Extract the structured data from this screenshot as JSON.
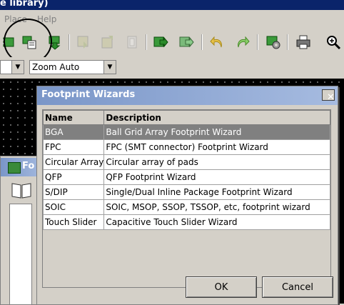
{
  "window": {
    "title": "e library)"
  },
  "menubar": {
    "items": [
      "Place",
      "Help"
    ]
  },
  "toolbar": {
    "buttons": [
      "new-footprint-icon",
      "footprint-wizard-icon",
      "load-footprint-icon",
      "save-library-icon",
      "export-icon",
      "delete-icon",
      "insert-board-icon",
      "update-board-icon",
      "undo-icon",
      "redo-icon",
      "settings-icon",
      "print-icon",
      "zoom-icon"
    ]
  },
  "toolbar2": {
    "zoom_value": "Zoom Auto"
  },
  "back_window": {
    "title": "Fo"
  },
  "dialog": {
    "title": "Footprint Wizards",
    "close_label": "✕",
    "columns": {
      "name": "Name",
      "description": "Description"
    },
    "rows": [
      {
        "name": "BGA",
        "description": "Ball Grid Array Footprint Wizard",
        "selected": true
      },
      {
        "name": "FPC",
        "description": "FPC (SMT connector) Footprint Wizard"
      },
      {
        "name": "Circular Array",
        "description": "Circular array of pads"
      },
      {
        "name": "QFP",
        "description": "QFP Footprint Wizard"
      },
      {
        "name": "S/DIP",
        "description": "Single/Dual Inline Package Footprint Wizard"
      },
      {
        "name": "SOIC",
        "description": "SOIC, MSOP, SSOP, TSSOP, etc, footprint wizard"
      },
      {
        "name": "Touch Slider",
        "description": "Capacitive Touch Slider Wizard"
      }
    ],
    "ok_label": "OK",
    "cancel_label": "Cancel"
  },
  "colors": {
    "title_gradient_start": "#7a96c8",
    "selected_row": "#808080",
    "canvas": "#000000"
  }
}
